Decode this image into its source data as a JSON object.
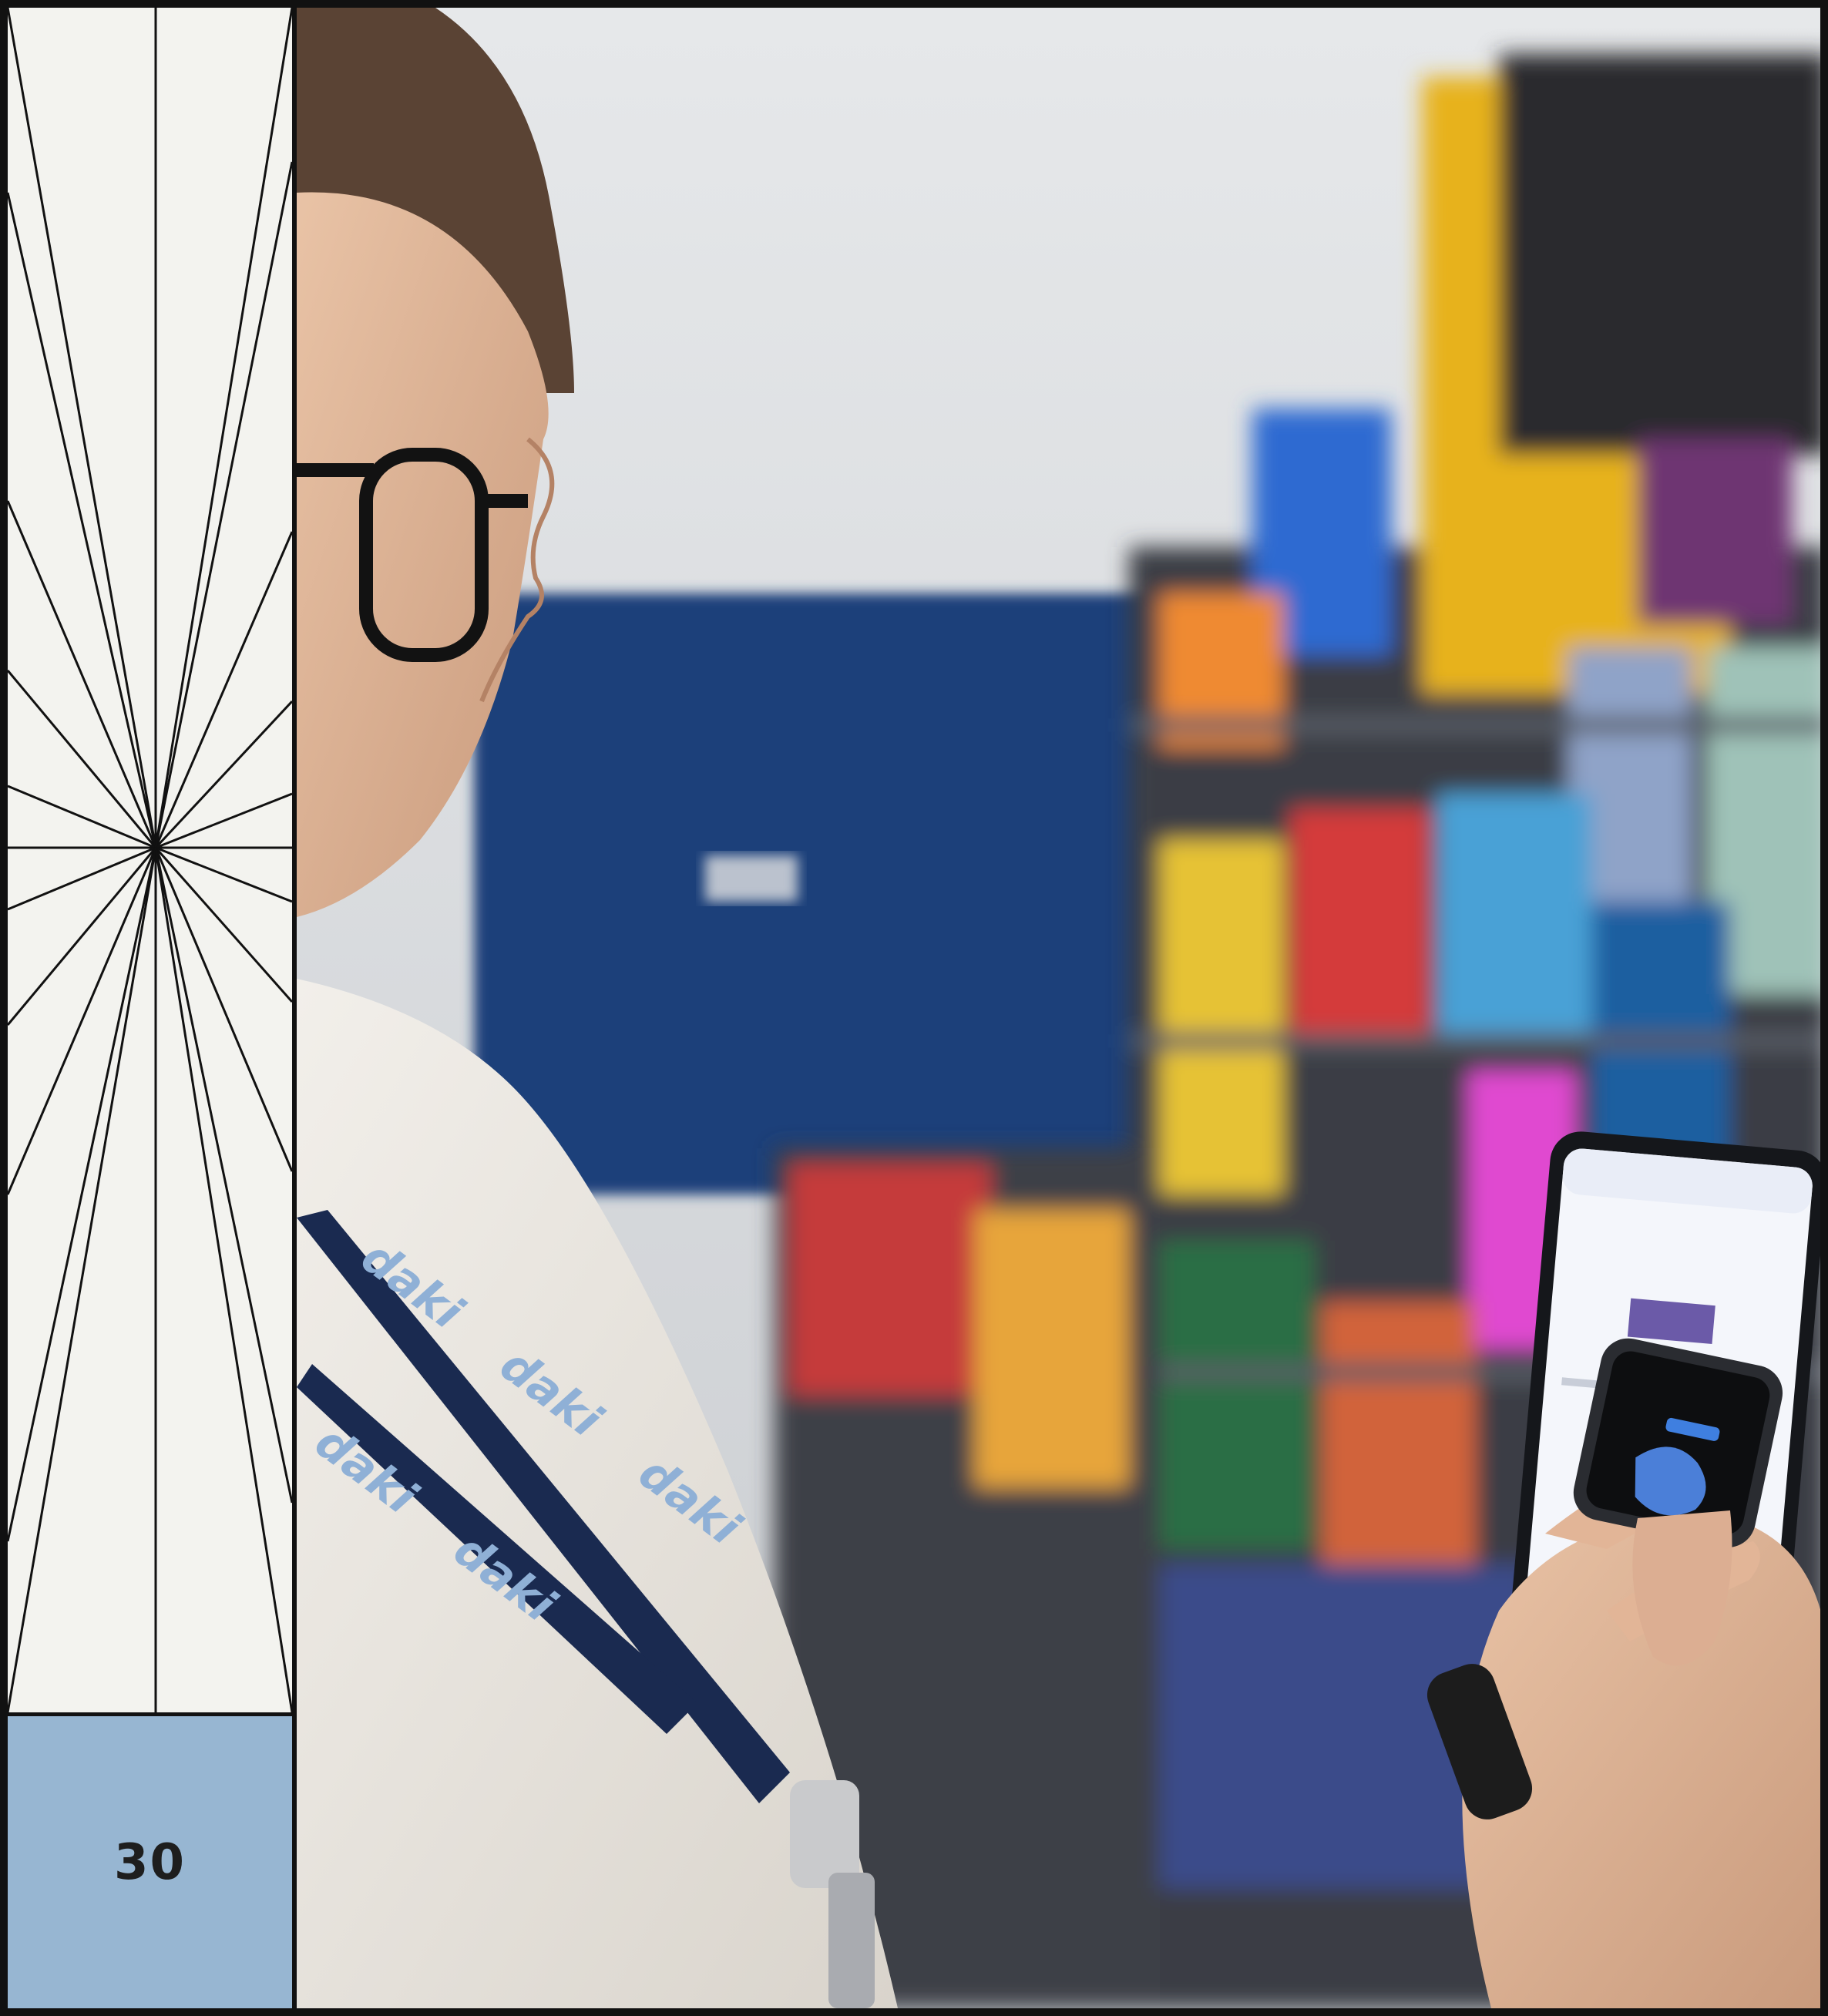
{
  "page": {
    "number": "30"
  },
  "photo": {
    "lanyard_text": "daki"
  },
  "colors": {
    "panel_background": "#f3f3ef",
    "page_number_box": "#97b6d2",
    "line_color": "#111111"
  }
}
